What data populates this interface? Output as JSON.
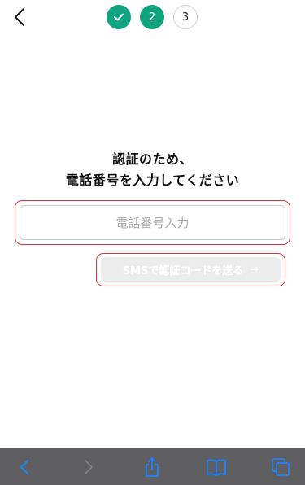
{
  "steps": [
    {
      "label": "",
      "state": "done",
      "icon": "check-icon"
    },
    {
      "label": "2",
      "state": "current"
    },
    {
      "label": "3",
      "state": "upcoming"
    }
  ],
  "heading": {
    "line1": "認証のため、",
    "line2": "電話番号を入力してください"
  },
  "phone": {
    "placeholder": "電話番号入力",
    "value": ""
  },
  "sms_button": {
    "label": "SMSで認証コードを送る",
    "arrow": "→",
    "enabled": false
  },
  "toolbar": {
    "icons": [
      "back-icon",
      "forward-icon",
      "share-icon",
      "bookmarks-icon",
      "tabs-icon"
    ]
  },
  "colors": {
    "step_active": "#0fa37f",
    "highlight": "#d23a3a",
    "button_disabled": "#ececec",
    "toolbar_bg": "#5f5f61",
    "toolbar_icon": "#1a84ff"
  }
}
